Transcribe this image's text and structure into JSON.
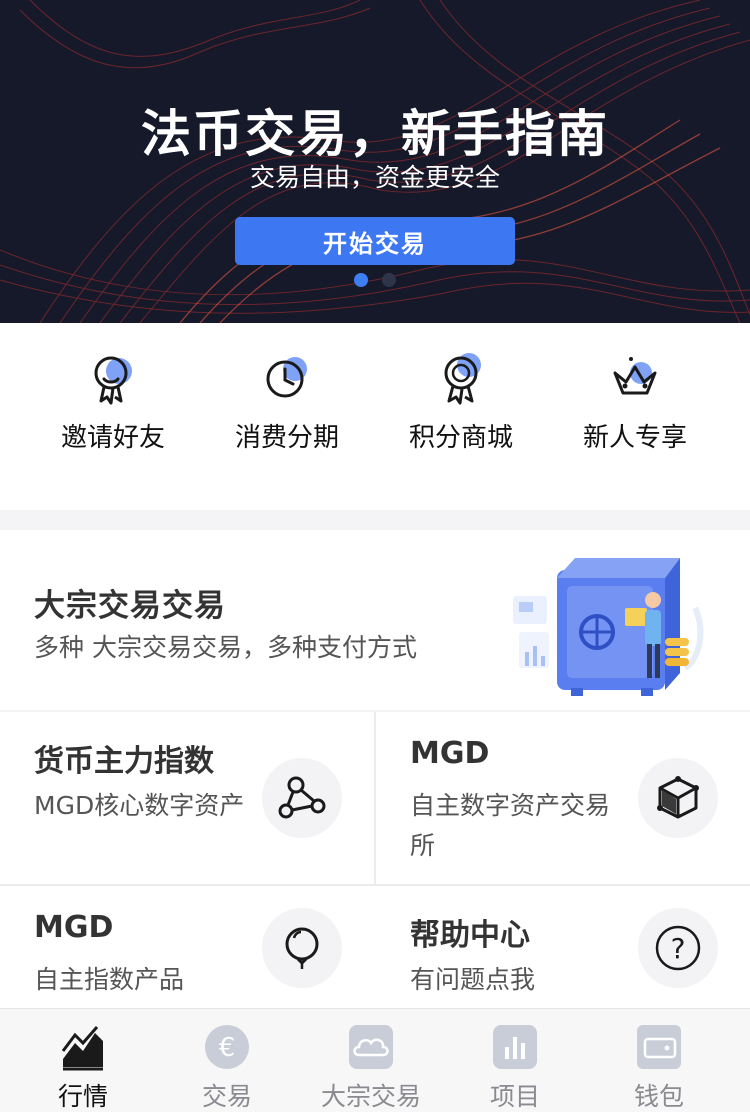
{
  "banner": {
    "title": "法币交易，新手指南",
    "subtitle": "交易自由，资金更安全",
    "button_label": "开始交易",
    "slide_count": 2,
    "active_slide": 1
  },
  "quick_menu": [
    {
      "label": "邀请好友",
      "icon": "medal-icon"
    },
    {
      "label": "消费分期",
      "icon": "clock-icon"
    },
    {
      "label": "积分商城",
      "icon": "badge-icon"
    },
    {
      "label": "新人专享",
      "icon": "crown-icon"
    }
  ],
  "feature_card": {
    "title": "大宗交易交易",
    "subtitle": "多种 大宗交易交易，多种支付方式",
    "illustration": "safe-illustration"
  },
  "grid_cards": [
    {
      "title": "货币主力指数",
      "subtitle": "MGD核心数字资产",
      "icon": "network-icon"
    },
    {
      "title": "MGD",
      "subtitle": "自主数字资产交易所",
      "icon": "cube-icon"
    },
    {
      "title": "MGD",
      "subtitle": "自主指数产品",
      "icon": "balloon-icon"
    },
    {
      "title": "帮助中心",
      "subtitle": "有问题点我",
      "icon": "question-icon"
    }
  ],
  "tabbar": [
    {
      "label": "行情",
      "icon": "chart-icon",
      "active": true
    },
    {
      "label": "交易",
      "icon": "euro-icon",
      "active": false
    },
    {
      "label": "大宗交易",
      "icon": "cloud-icon",
      "active": false
    },
    {
      "label": "项目",
      "icon": "bar-icon",
      "active": false
    },
    {
      "label": "钱包",
      "icon": "wallet-icon",
      "active": false
    }
  ],
  "colors": {
    "accent": "#3d78f2",
    "icon_accent": "#7fa2f7",
    "banner_bg": "#15192a",
    "wave": "#c0392b"
  }
}
